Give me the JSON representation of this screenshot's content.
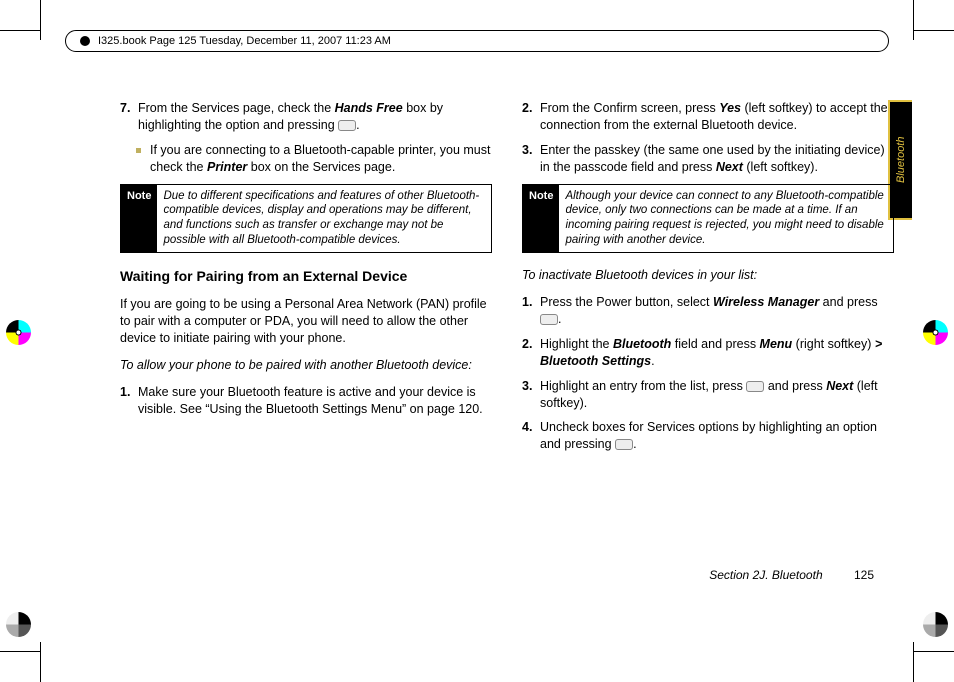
{
  "header": "I325.book  Page 125  Tuesday, December 11, 2007  11:23 AM",
  "sidetab": "Bluetooth",
  "left": {
    "step7_a": "From the Services page, check the ",
    "step7_b": "Hands Free",
    "step7_c": " box by highlighting the option and pressing ",
    "sub_a": "If you are connecting to a Bluetooth-capable printer, you must check the ",
    "sub_b": "Printer",
    "sub_c": " box on the Services page.",
    "note_label": "Note",
    "note_text": "Due to different specifications and features of other Bluetooth-compatible devices, display and operations may be different, and functions such as transfer or exchange may not be possible with all Bluetooth-compatible devices.",
    "subhead": "Waiting for Pairing from an External Device",
    "para": "If you are going to be using a Personal Area Network (PAN) profile to pair with a computer or PDA, you will need to allow the other device to initiate pairing with your phone.",
    "lead": "To allow your phone to be paired with another Bluetooth device:",
    "step1": "Make sure your Bluetooth feature is active and your device is visible. See “Using the Bluetooth Settings Menu” on page 120."
  },
  "right": {
    "step2_a": "From the Confirm screen, press ",
    "step2_b": "Yes",
    "step2_c": " (left softkey) to accept the connection from the external Bluetooth device.",
    "step3_a": "Enter the passkey (the same one used by the initiating device) in the passcode field and press ",
    "step3_b": "Next",
    "step3_c": " (left softkey).",
    "note_label": "Note",
    "note_text": "Although your device can connect to any Bluetooth-compatible device, only two connections can be made at a time. If an incoming pairing request is rejected, you might need to disable pairing with another device.",
    "lead2": "To inactivate Bluetooth devices in your list:",
    "b1_a": "Press the Power button, select ",
    "b1_b": "Wireless Manager",
    "b1_c": " and press ",
    "b2_a": "Highlight the ",
    "b2_b": "Bluetooth",
    "b2_c": " field and press ",
    "b2_d": "Menu",
    "b2_e": " (right softkey) ",
    "b2_f": "> Bluetooth Settings",
    "b3_a": "Highlight an entry from the list, press ",
    "b3_b": " and press ",
    "b3_c": "Next",
    "b3_d": " (left softkey).",
    "b4_a": "Uncheck boxes for Services options by highlighting an option and pressing "
  },
  "footer": {
    "section": "Section 2J. Bluetooth",
    "page": "125"
  }
}
